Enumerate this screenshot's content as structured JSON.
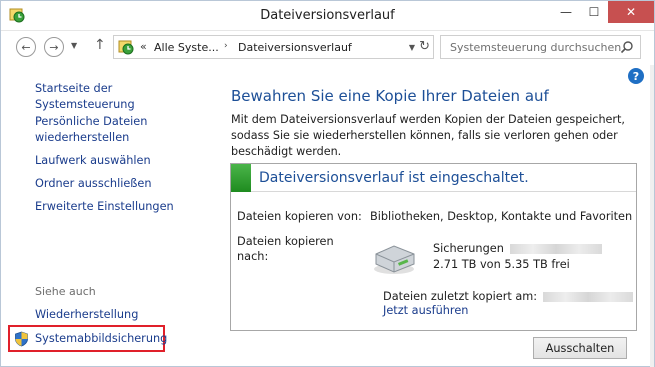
{
  "window": {
    "title": "Dateiversionsverlauf",
    "close_glyph": "✕",
    "minimize_glyph": "—",
    "maximize_glyph": "☐"
  },
  "address": {
    "back_glyph": "←",
    "forward_glyph": "→",
    "up_glyph": "↑",
    "separator_glyph": "«",
    "crumb_arrow": "›",
    "crumbs": [
      "Alle Syste...",
      "Dateiversionsverlauf"
    ],
    "search_placeholder": "Systemsteuerung durchsuchen"
  },
  "sidebar": {
    "items": [
      {
        "label": "Startseite der Systemsteuerung"
      },
      {
        "label": "Persönliche Dateien"
      },
      {
        "label": "wiederherstellen"
      },
      {
        "label": "Laufwerk auswählen"
      },
      {
        "label": "Ordner ausschließen"
      },
      {
        "label": "Erweiterte Einstellungen"
      }
    ],
    "see_also_label": "Siehe auch",
    "see_also": [
      {
        "label": "Wiederherstellung"
      },
      {
        "label": "Systemabbildsicherung"
      }
    ]
  },
  "main": {
    "help_glyph": "?",
    "heading": "Bewahren Sie eine Kopie Ihrer Dateien auf",
    "description": "Mit dem Dateiversionsverlauf werden Kopien der Dateien gespeichert, sodass Sie sie wiederherstellen können, falls sie verloren gehen oder beschädigt werden.",
    "status": {
      "text": "Dateiversionsverlauf ist eingeschaltet.",
      "color": "#2e9a2f"
    },
    "copy_from_label": "Dateien kopieren von:",
    "copy_from_value": "Bibliotheken, Desktop, Kontakte und Favoriten",
    "copy_to_label_1": "Dateien kopieren",
    "copy_to_label_2": "nach:",
    "drive_name": "Sicherungen",
    "drive_space": "2.71 TB von 5.35 TB frei",
    "last_copied_label": "Dateien zuletzt kopiert am:",
    "run_now": "Jetzt ausführen",
    "turn_off_button": "Ausschalten"
  },
  "colors": {
    "link": "#1a3c8c",
    "heading": "#1d4f97",
    "highlight_border": "#e0202a",
    "close_button": "#c75050"
  },
  "icons": [
    "file-history-icon",
    "search-icon",
    "refresh-icon",
    "help-icon",
    "shield-icon",
    "drive-icon"
  ]
}
